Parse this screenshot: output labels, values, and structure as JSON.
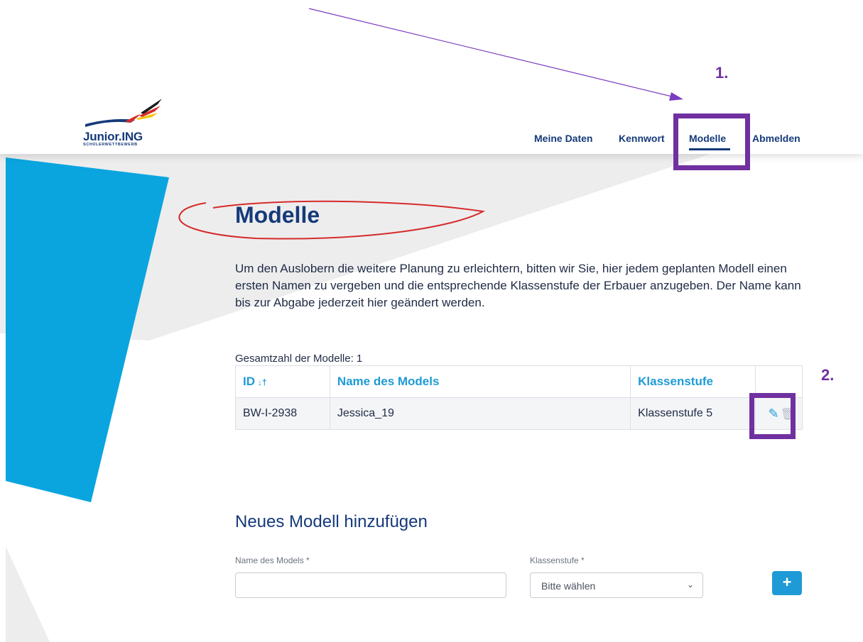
{
  "header": {
    "logo": {
      "name": "Junior.ING",
      "subtitle": "SCHÜLERWETTBEWERB"
    },
    "nav": [
      {
        "label": "Meine Daten"
      },
      {
        "label": "Kennwort"
      },
      {
        "label": "Modelle",
        "active": true
      },
      {
        "label": "Abmelden"
      }
    ]
  },
  "annotations": {
    "step1": "1.",
    "step2": "2."
  },
  "main": {
    "title": "Modelle",
    "intro": "Um den Auslobern die weitere Planung zu erleichtern, bitten wir Sie, hier jedem geplanten Modell einen ersten Namen zu vergeben und die entsprechende Klassenstufe der Erbauer anzugeben. Der Name kann bis zur Abgabe jederzeit hier geändert werden.",
    "count_label": "Gesamtzahl der Modelle: 1",
    "table": {
      "columns": [
        "ID",
        "Name des Models",
        "Klassenstufe",
        ""
      ],
      "rows": [
        {
          "id": "BW-I-2938",
          "name": "Jessica_19",
          "klassenstufe": "Klassenstufe 5"
        }
      ]
    },
    "new_model": {
      "title": "Neues Modell hinzufügen",
      "name_label": "Name des Models *",
      "name_value": "",
      "class_label": "Klassenstufe *",
      "class_selected": "Bitte wählen",
      "add_button": "+"
    }
  },
  "colors": {
    "brand": "#153a7a",
    "accent": "#1e9ad6",
    "annotation": "#7030a0",
    "highlight": "#d62b2b"
  }
}
